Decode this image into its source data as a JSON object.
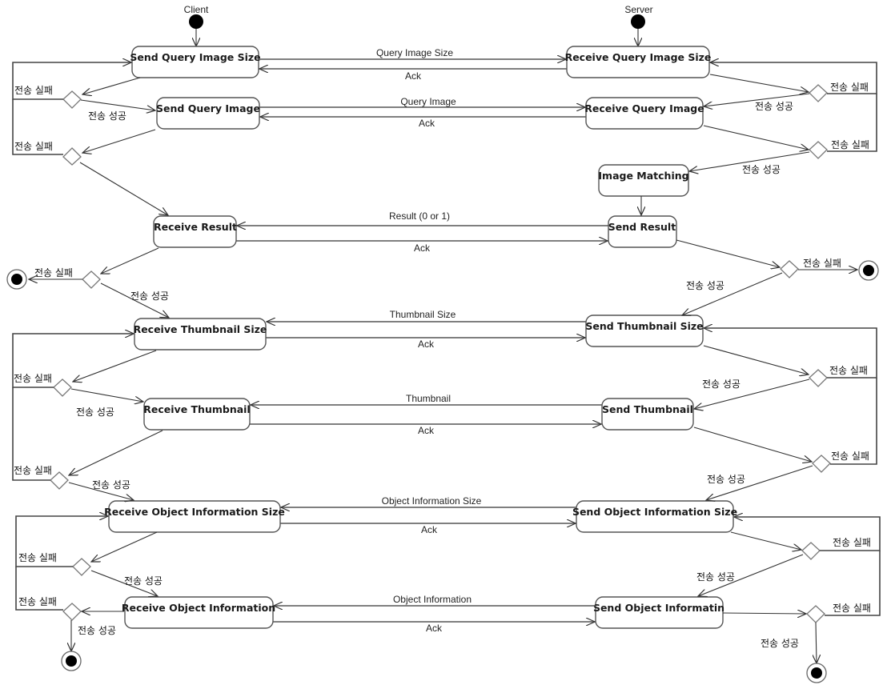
{
  "actors": {
    "client": "Client",
    "server": "Server"
  },
  "guards": {
    "fail": "전송 실패",
    "success": "전송 성공"
  },
  "client_states": [
    {
      "id": "c1",
      "label": "Send Query Image Size"
    },
    {
      "id": "c2",
      "label": "Send Query Image"
    },
    {
      "id": "c3",
      "label": "Receive Result"
    },
    {
      "id": "c4",
      "label": "Receive Thumbnail Size"
    },
    {
      "id": "c5",
      "label": "Receive Thumbnail"
    },
    {
      "id": "c6",
      "label": "Receive Object Information Size"
    },
    {
      "id": "c7",
      "label": "Receive Object Information"
    }
  ],
  "server_states": [
    {
      "id": "s1",
      "label": "Receive Query Image Size"
    },
    {
      "id": "s2",
      "label": "Receive Query Image"
    },
    {
      "id": "s2b",
      "label": "Image Matching"
    },
    {
      "id": "s3",
      "label": "Send Result"
    },
    {
      "id": "s4",
      "label": "Send Thumbnail Size"
    },
    {
      "id": "s5",
      "label": "Send Thumbnail"
    },
    {
      "id": "s6",
      "label": "Send Object Information Size"
    },
    {
      "id": "s7",
      "label": "Send Object Informatin"
    }
  ],
  "messages": [
    {
      "pair": "c1-s1",
      "data": "Query Image Size",
      "ack": "Ack",
      "direction": "client-to-server"
    },
    {
      "pair": "c2-s2",
      "data": "Query Image",
      "ack": "Ack",
      "direction": "client-to-server"
    },
    {
      "pair": "s3-c3",
      "data": "Result (0 or 1)",
      "ack": "Ack",
      "direction": "server-to-client"
    },
    {
      "pair": "s4-c4",
      "data": "Thumbnail Size",
      "ack": "Ack",
      "direction": "server-to-client"
    },
    {
      "pair": "s5-c5",
      "data": "Thumbnail",
      "ack": "Ack",
      "direction": "server-to-client"
    },
    {
      "pair": "s6-c6",
      "data": "Object Information Size",
      "ack": "Ack",
      "direction": "server-to-client"
    },
    {
      "pair": "s7-c7",
      "data": "Object Information",
      "ack": "Ack",
      "direction": "server-to-client"
    }
  ]
}
